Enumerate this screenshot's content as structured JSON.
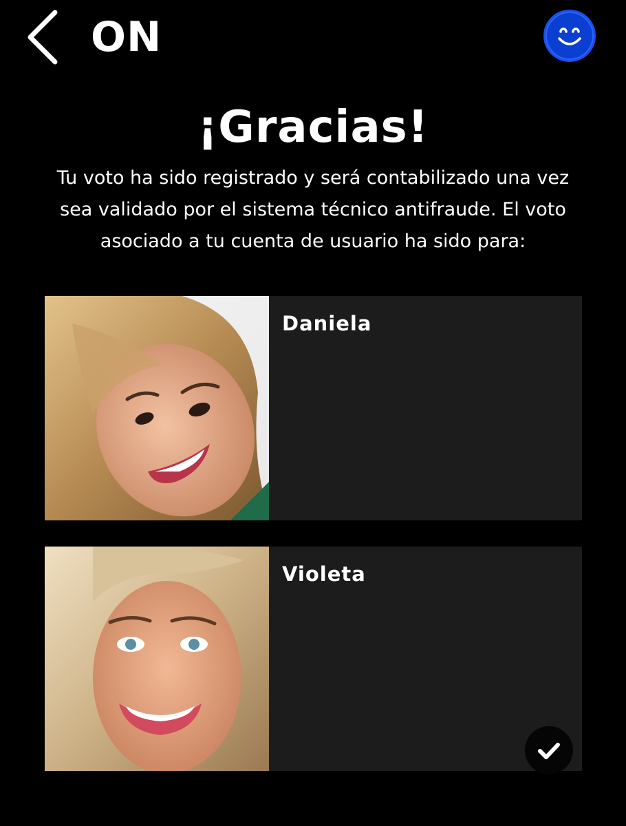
{
  "header": {
    "back_icon": "chevron-left-icon",
    "brand": "ON",
    "profile_icon": "smiley-face-icon",
    "profile_color": "#0b3fd1"
  },
  "confirmation": {
    "title": "¡Gracias!",
    "message_line1": "Tu voto ha sido registrado y será contabilizado una vez",
    "message_line2": "sea validado por el sistema técnico antifraude. El voto",
    "message_line3": "asociado a tu cuenta de usuario ha sido para:"
  },
  "candidates": [
    {
      "name": "Daniela",
      "selected": false
    },
    {
      "name": "Violeta",
      "selected": true,
      "selected_icon": "checkmark-icon"
    }
  ],
  "colors": {
    "background": "#000000",
    "card_background": "#1c1c1c",
    "text": "#ffffff"
  }
}
